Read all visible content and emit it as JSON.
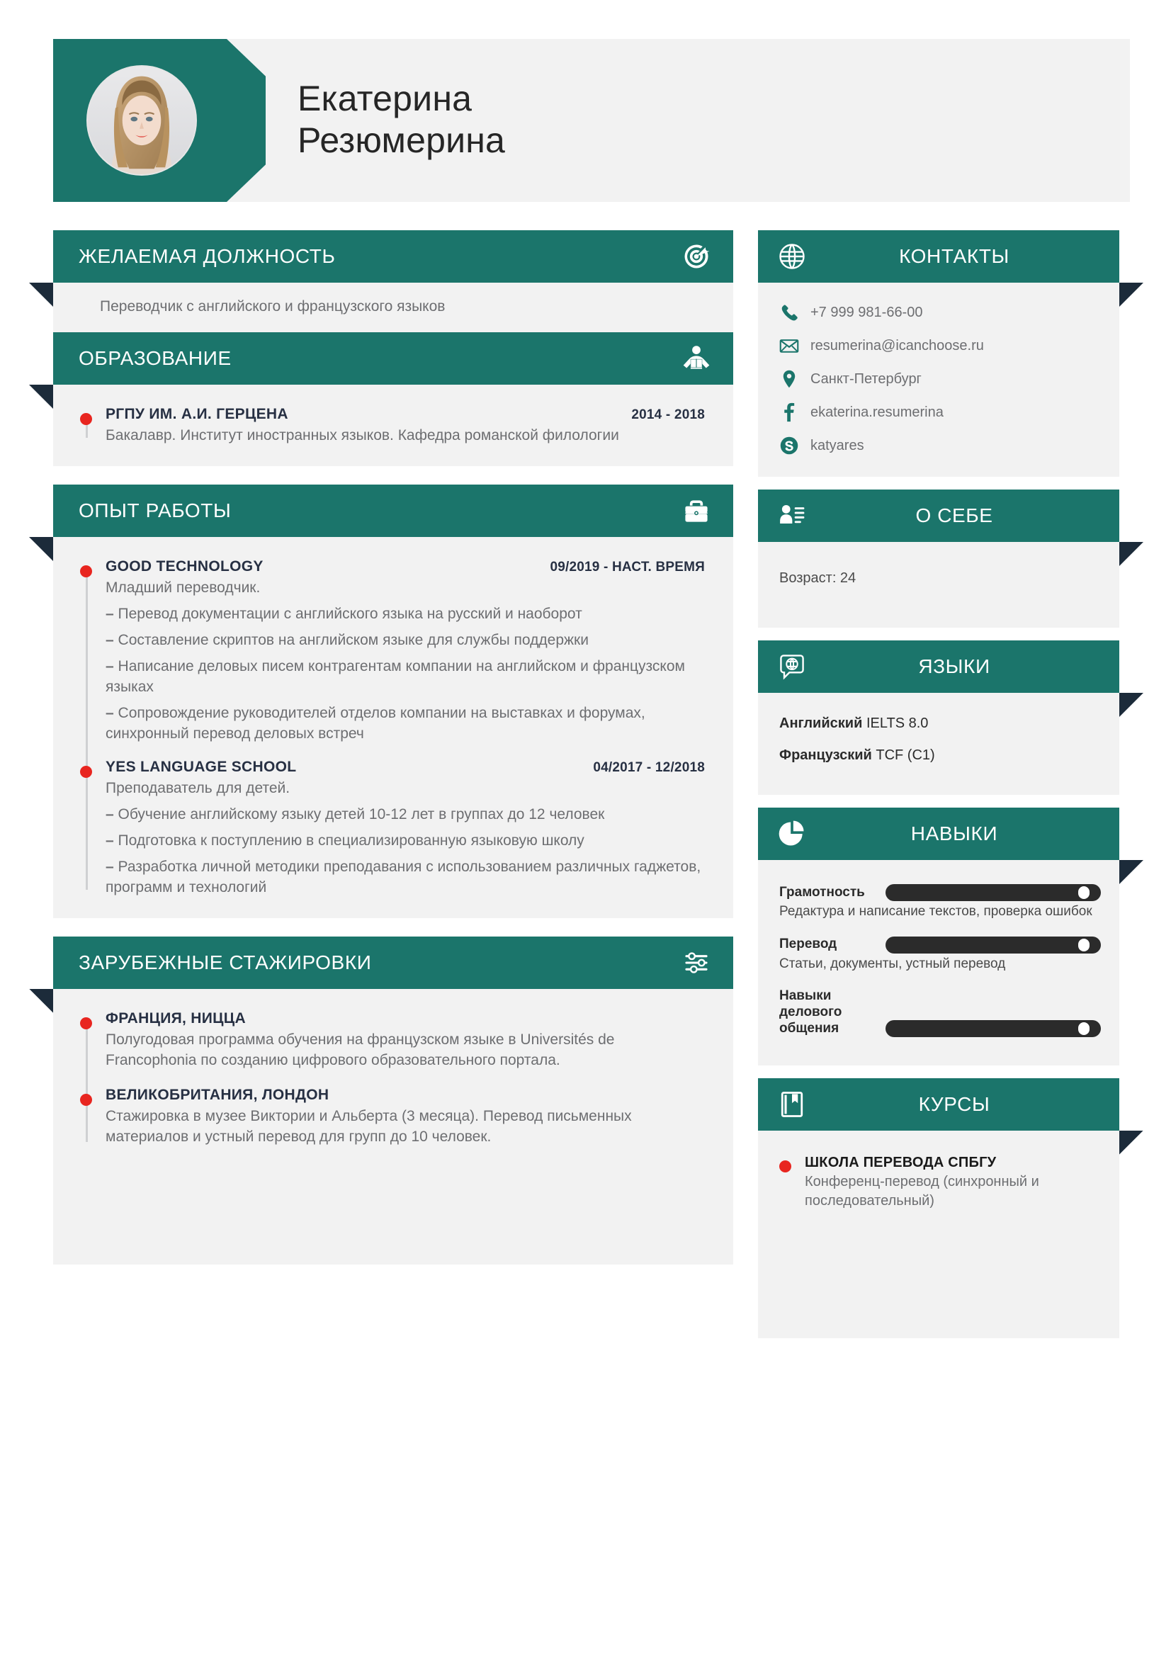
{
  "person": {
    "first_name": "Екатерина",
    "last_name": "Резюмерина",
    "avatar_alt": "portrait-photo"
  },
  "left_sections": {
    "objective": {
      "title": "ЖЕЛАЕМАЯ ДОЛЖНОСТЬ",
      "icon": "target-icon",
      "text": "Переводчик с английского и французского языков"
    },
    "education": {
      "title": "ОБРАЗОВАНИЕ",
      "icon": "reading-person-icon",
      "items": [
        {
          "title": "РГПУ ИМ. А.И. ГЕРЦЕНА",
          "date": "2014 - 2018",
          "subtitle": "Бакалавр. Институт иностранных языков. Кафедра романской филологии",
          "bullets": []
        }
      ]
    },
    "experience": {
      "title": "ОПЫТ РАБОТЫ",
      "icon": "briefcase-icon",
      "items": [
        {
          "title": "GOOD TECHNOLOGY",
          "date": "09/2019 - НАСТ. ВРЕМЯ",
          "subtitle": "Младший переводчик.",
          "bullets": [
            "Перевод документации с английского языка на русский и наоборот",
            "Составление скриптов на английском языке для службы поддержки",
            "Написание деловых писем контрагентам компании на английском и французском языках",
            "Сопровождение руководителей отделов компании на выставках и форумах, синхронный перевод деловых встреч"
          ]
        },
        {
          "title": "YES LANGUAGE SCHOOL",
          "date": "04/2017 - 12/2018",
          "subtitle": "Преподаватель для детей.",
          "bullets": [
            "Обучение английскому языку детей 10-12 лет в группах до 12 человек",
            "Подготовка к поступлению в специализированную языковую школу",
            "Разработка личной методики преподавания с использованием различных гаджетов, программ и технологий"
          ]
        }
      ]
    },
    "internships": {
      "title": "ЗАРУБЕЖНЫЕ СТАЖИРОВКИ",
      "icon": "sliders-icon",
      "items": [
        {
          "title": "ФРАНЦИЯ, НИЦЦА",
          "date": "",
          "subtitle": "Полугодовая программа обучения на французском языке в Universités de Francophonia по созданию цифрового образовательного портала.",
          "bullets": []
        },
        {
          "title": "ВЕЛИКОБРИТАНИЯ, ЛОНДОН",
          "date": "",
          "subtitle": "Стажировка в музее Виктории и Альберта (3 месяца). Перевод письменных материалов и устный перевод для групп до 10 человек.",
          "bullets": []
        }
      ]
    }
  },
  "right_sections": {
    "contacts": {
      "title": "КОНТАКТЫ",
      "icon": "globe-icon",
      "items": [
        {
          "icon": "phone-icon",
          "value": "+7 999 981-66-00"
        },
        {
          "icon": "envelope-icon",
          "value": "resumerina@icanchoose.ru"
        },
        {
          "icon": "location-pin-icon",
          "value": "Санкт-Петербург"
        },
        {
          "icon": "facebook-icon",
          "value": "ekaterina.resumerina"
        },
        {
          "icon": "skype-icon",
          "value": "katyares"
        }
      ]
    },
    "about": {
      "title": "О СЕБЕ",
      "icon": "id-card-icon",
      "text": "Возраст: 24"
    },
    "languages": {
      "title": "ЯЗЫКИ",
      "icon": "globe-speech-icon",
      "items": [
        {
          "name": "Английский",
          "level": "IELTS 8.0"
        },
        {
          "name": "Французский",
          "level": "TCF (C1)"
        }
      ]
    },
    "skills": {
      "title": "НАВЫКИ",
      "icon": "pie-chart-icon",
      "items": [
        {
          "name": "Грамотность",
          "description": "Редактура и написание текстов, проверка ошибок",
          "level": 92
        },
        {
          "name": "Перевод",
          "description": "Статьи, документы, устный перевод",
          "level": 92
        },
        {
          "name": "Навыки делового общения",
          "description": "",
          "level": 92
        }
      ]
    },
    "courses": {
      "title": "КУРСЫ",
      "icon": "book-bookmark-icon",
      "items": [
        {
          "title": "ШКОЛА ПЕРЕВОДА СПБГУ",
          "description": "Конференц-перевод (синхронный и последовательный)"
        }
      ]
    }
  },
  "colors": {
    "accent_teal": "#1b756b",
    "fold_navy": "#1c2b3a",
    "panel_gray": "#f2f2f2",
    "bullet_red": "#e8251f",
    "skill_bar": "#2b2b2b",
    "text_dark": "#273043",
    "text_gray": "#6d6e71"
  }
}
